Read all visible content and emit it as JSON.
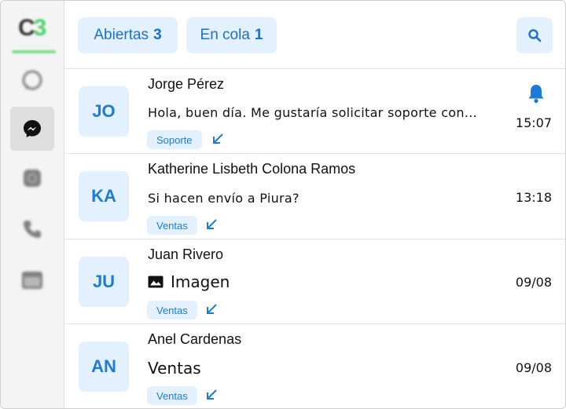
{
  "sidebar": {
    "logo_text": "C",
    "logo_accent": "3",
    "items": [
      {
        "icon": "whatsapp-icon",
        "active": false
      },
      {
        "icon": "messenger-icon",
        "active": true
      },
      {
        "icon": "instagram-icon",
        "active": false
      },
      {
        "icon": "phone-icon",
        "active": false
      },
      {
        "icon": "calendar-icon",
        "active": false
      }
    ]
  },
  "tabs": {
    "open_label": "Abiertas",
    "open_count": "3",
    "queue_label": "En cola",
    "queue_count": "1"
  },
  "search": {
    "icon": "search-icon"
  },
  "conversations": [
    {
      "initials": "JO",
      "name": "Jorge Pérez",
      "preview": "Hola, buen día. Me gustaría solicitar soporte con...",
      "tag": "Soporte",
      "time": "15:07",
      "notification": true
    },
    {
      "initials": "KA",
      "name": "Katherine Lisbeth Colona Ramos",
      "preview": "Si hacen envío a Piura?",
      "tag": "Ventas",
      "time": "13:18"
    },
    {
      "initials": "JU",
      "name": "Juan Rivero",
      "preview": "Imagen",
      "preview_icon": "image-icon",
      "tag": "Ventas",
      "time": "09/08"
    },
    {
      "initials": "AN",
      "name": "Anel Cardenas",
      "preview": "Ventas",
      "tag": "Ventas",
      "time": "09/08"
    }
  ],
  "colors": {
    "accent": "#1c7bd6",
    "pill_bg": "#e3f0fd",
    "logo_green": "#4bd06a"
  }
}
